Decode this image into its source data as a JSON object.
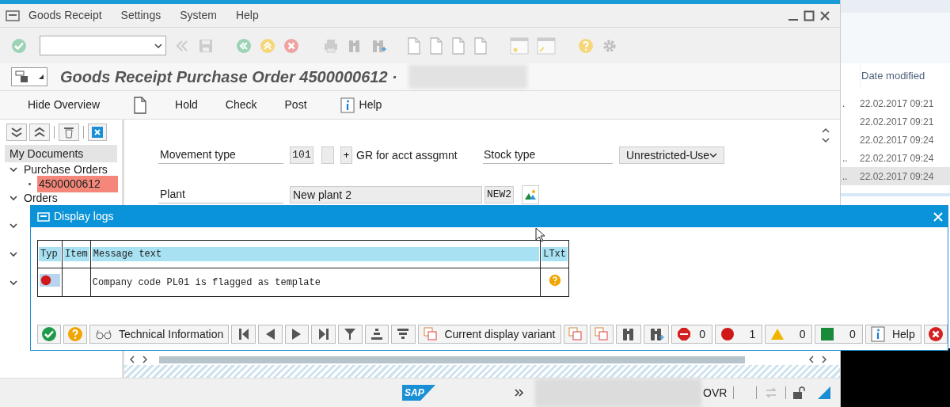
{
  "menu": [
    "Goods Receipt",
    "Settings",
    "System",
    "Help"
  ],
  "title": "Goods Receipt Purchase Order 4500000612 ·",
  "app_toolbar": [
    {
      "kind": "text",
      "label": "Hide Overview"
    },
    {
      "kind": "page"
    },
    {
      "kind": "text",
      "label": "Hold"
    },
    {
      "kind": "text",
      "label": "Check"
    },
    {
      "kind": "text",
      "label": "Post"
    },
    {
      "kind": "info",
      "label": "Help"
    }
  ],
  "tree": {
    "header": "My Documents",
    "items": [
      {
        "label": "Purchase Orders",
        "expanded": true,
        "children": [
          {
            "label": "4500000612",
            "selected": true
          }
        ]
      },
      {
        "label": "Orders",
        "expanded": true
      },
      {
        "expanded": true
      },
      {
        "expanded": true
      },
      {
        "expanded": true
      }
    ]
  },
  "form": {
    "movement_type": {
      "label": "Movement type",
      "code": "101",
      "sign": "+",
      "text": "GR for acct assgmnt"
    },
    "stock_type": {
      "label": "Stock type",
      "value": "Unrestricted-Use"
    },
    "plant": {
      "label": "Plant",
      "value": "New plant 2",
      "code": "NEW2"
    }
  },
  "dialog": {
    "title": "Display logs",
    "columns": [
      "Typ",
      "Item",
      "Message text",
      "LTxt"
    ],
    "rows": [
      {
        "kind": "error",
        "message": "Company code PL01 is flagged as template",
        "long_text": true
      }
    ],
    "toolbar": [
      {
        "kind": "check"
      },
      {
        "kind": "help"
      },
      {
        "kind": "glasses",
        "label": "Technical Information"
      },
      {
        "kind": "first"
      },
      {
        "kind": "prev"
      },
      {
        "kind": "next"
      },
      {
        "kind": "last"
      },
      {
        "kind": "filter"
      },
      {
        "kind": "total"
      },
      {
        "kind": "subtotal"
      },
      {
        "kind": "layout",
        "label": "Current display variant"
      },
      {
        "kind": "layout"
      },
      {
        "kind": "layout"
      },
      {
        "kind": "find"
      },
      {
        "kind": "find-next"
      },
      {
        "kind": "stop",
        "count": "0"
      },
      {
        "kind": "error",
        "count": "1"
      },
      {
        "kind": "warning",
        "count": "0"
      },
      {
        "kind": "success",
        "count": "0"
      },
      {
        "kind": "info",
        "label": "Help"
      },
      {
        "kind": "cancel"
      }
    ]
  },
  "status_bar": {
    "logo": "SAP",
    "mode": "OVR"
  },
  "explorer": {
    "header": "Date modified",
    "rows": [
      {
        "name": ".",
        "date": "22.02.2017 09:21",
        "selected": false
      },
      {
        "date": "22.02.2017 09:21",
        "selected": false
      },
      {
        "date": "22.02.2017 09:24",
        "selected": false
      },
      {
        "name": "..",
        "date": "22.02.2017 09:24",
        "selected": false
      },
      {
        "name": "..",
        "date": "22.02.2017 09:24",
        "selected": true
      }
    ]
  }
}
